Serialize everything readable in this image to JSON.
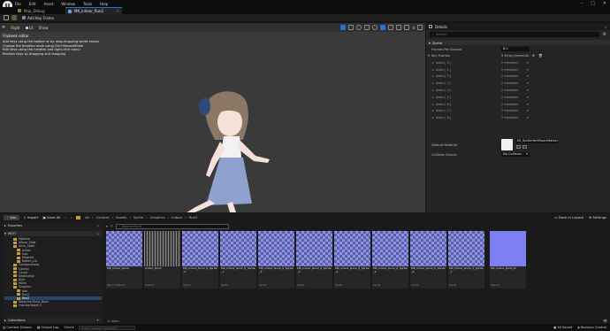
{
  "menu": {
    "items": [
      "File",
      "Edit",
      "Asset",
      "Window",
      "Tools",
      "Help"
    ]
  },
  "tabs": [
    {
      "label": "Map_Debug"
    },
    {
      "label": "MK_Indoor_Run2"
    }
  ],
  "toolbar": {
    "add_key_frame": "Add Key Frame"
  },
  "viewport": {
    "view_mode": "Right",
    "lit_label": "Lit",
    "show_label": "Show",
    "info_title": "Flipbook editor",
    "info_lines": [
      "Add keys using the toolbar or by drag-dropping sprite assets",
      "Change the timeline scale using Ctrl+MouseWheel",
      "Edit keys using the handles and right-click menu",
      "Reorder keys by dragging and dropping"
    ],
    "speed_value": "4"
  },
  "details": {
    "tab_label": "Details",
    "search_placeholder": "Search",
    "section_sprite": "Sprite",
    "frames_per_second_label": "Frames Per Second",
    "frames_per_second_value": "8.0",
    "key_frames_label": "Key Frames",
    "key_frames_value": "9 Array elements",
    "rows": [
      {
        "label": "Index [ 0 ]",
        "value": "2 members"
      },
      {
        "label": "Index [ 1 ]",
        "value": "2 members"
      },
      {
        "label": "Index [ 2 ]",
        "value": "2 members"
      },
      {
        "label": "Index [ 3 ]",
        "value": "2 members"
      },
      {
        "label": "Index [ 4 ]",
        "value": "2 members"
      },
      {
        "label": "Index [ 5 ]",
        "value": "2 members"
      },
      {
        "label": "Index [ 6 ]",
        "value": "2 members"
      },
      {
        "label": "Index [ 7 ]",
        "value": "2 members"
      },
      {
        "label": "Index [ 8 ]",
        "value": "2 members"
      }
    ],
    "default_material_label": "Default Material",
    "default_material_value": "MI_SpriteVertPaperMaterial",
    "collision_source_label": "Collision Source",
    "collision_source_value": "No Collision"
  },
  "content_browser": {
    "add_label": "Add",
    "import_label": "Import",
    "save_all_label": "Save All",
    "breadcrumb": [
      "All",
      "Content",
      "Assets",
      "Sprite",
      "Graphics",
      "Indoor",
      "Run2"
    ],
    "dock_label": "Dock in Layout",
    "settings_label": "Settings",
    "favorites_label": "Favorites",
    "project_label": "MOTI",
    "search_placeholder": "Search Run2",
    "items_count": "11 items",
    "collections_label": "Collections",
    "tree": [
      "Material",
      "Album_Slots",
      "Anim_State",
      "Action",
      "Icon",
      "Material",
      "Rotten_Lid",
      "Configurations",
      "Control",
      "Cursor",
      "Destination",
      "Dice",
      "Fallen",
      "Graphics",
      "Idle",
      "Run2",
      "Run2",
      "Sketches Music_Bank",
      "OverlayObject.0"
    ],
    "assets": [
      {
        "name": "MK_Indoor_Run2",
        "type": "Paper Flipbook"
      },
      {
        "name": "Indoor_Run2",
        "type": "Texture"
      },
      {
        "name": "MK_Indoor_Run2_0_Sprite_0",
        "type": "Sprite"
      },
      {
        "name": "MK_Indoor_Run2_0_Sprite_1",
        "type": "Sprite"
      },
      {
        "name": "MK_Indoor_Run2_0_Sprite_2",
        "type": "Sprite"
      },
      {
        "name": "MK_Indoor_Run2_0_Sprite_3",
        "type": "Sprite"
      },
      {
        "name": "MK_Indoor_Run2_0_Sprite_4",
        "type": "Sprite"
      },
      {
        "name": "MK_Indoor_Run2_0_Sprite_5",
        "type": "Sprite"
      },
      {
        "name": "MK_Indoor_Run2_0_Sprite_6",
        "type": "Sprite"
      },
      {
        "name": "MK_Indoor_Run2_0_Sprite_7",
        "type": "Sprite"
      },
      {
        "name": "MK_Indoor_Run2_N",
        "type": "Texture"
      }
    ]
  },
  "statusbar": {
    "content_drawer": "Content Drawer",
    "output_log": "Output Log",
    "cmd_label": "Cmd",
    "cmd_placeholder": "Enter Console Command",
    "all_saved": "All Saved",
    "revision_control": "Revision Control"
  },
  "colors": {
    "accent": "#2a6fd6",
    "checker_a": "#5b5fb4",
    "checker_b": "#8e93d8",
    "normal_map": "#7e7ff5",
    "folder": "#c49a3c"
  }
}
